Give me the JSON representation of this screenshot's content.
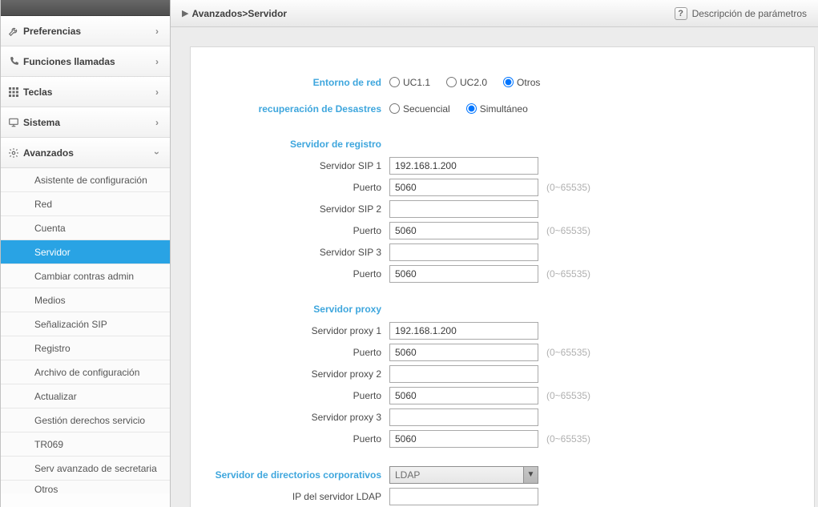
{
  "breadcrumb": {
    "text": "Avanzados>Servidor"
  },
  "help": {
    "label": "Descripción de parámetros"
  },
  "sidebar": {
    "sections": [
      {
        "label": "Preferencias",
        "icon": "wrench",
        "expanded": false
      },
      {
        "label": "Funciones llamadas",
        "icon": "phone",
        "expanded": false
      },
      {
        "label": "Teclas",
        "icon": "grid",
        "expanded": false
      },
      {
        "label": "Sistema",
        "icon": "monitor",
        "expanded": false
      },
      {
        "label": "Avanzados",
        "icon": "gear",
        "expanded": true
      }
    ],
    "advanced_items": [
      "Asistente de configuración",
      "Red",
      "Cuenta",
      "Servidor",
      "Cambiar contras admin",
      "Medios",
      "Señalización SIP",
      "Registro",
      "Archivo de configuración",
      "Actualizar",
      "Gestión derechos servicio",
      "TR069",
      "Serv avanzado de secretaria",
      "Otros"
    ],
    "active_index": 3
  },
  "form": {
    "network_env": {
      "label": "Entorno de red",
      "options": [
        "UC1.1",
        "UC2.0",
        "Otros"
      ],
      "selected": "Otros"
    },
    "disaster_recovery": {
      "label": "recuperación de Desastres",
      "options": [
        "Secuencial",
        "Simultáneo"
      ],
      "selected": "Simultáneo"
    },
    "reg_server": {
      "section": "Servidor de registro",
      "rows": [
        {
          "label": "Servidor SIP 1",
          "value": "192.168.1.200",
          "hint": ""
        },
        {
          "label": "Puerto",
          "value": "5060",
          "hint": "(0~65535)"
        },
        {
          "label": "Servidor SIP 2",
          "value": "",
          "hint": ""
        },
        {
          "label": "Puerto",
          "value": "5060",
          "hint": "(0~65535)"
        },
        {
          "label": "Servidor SIP 3",
          "value": "",
          "hint": ""
        },
        {
          "label": "Puerto",
          "value": "5060",
          "hint": "(0~65535)"
        }
      ]
    },
    "proxy_server": {
      "section": "Servidor proxy",
      "rows": [
        {
          "label": "Servidor proxy 1",
          "value": "192.168.1.200",
          "hint": ""
        },
        {
          "label": "Puerto",
          "value": "5060",
          "hint": "(0~65535)"
        },
        {
          "label": "Servidor proxy 2",
          "value": "",
          "hint": ""
        },
        {
          "label": "Puerto",
          "value": "5060",
          "hint": "(0~65535)"
        },
        {
          "label": "Servidor proxy 3",
          "value": "",
          "hint": ""
        },
        {
          "label": "Puerto",
          "value": "5060",
          "hint": "(0~65535)"
        }
      ]
    },
    "corp_dir": {
      "label": "Servidor de directorios corporativos",
      "selected": "LDAP"
    },
    "ldap_ip": {
      "label": "IP del servidor LDAP",
      "value": ""
    }
  }
}
